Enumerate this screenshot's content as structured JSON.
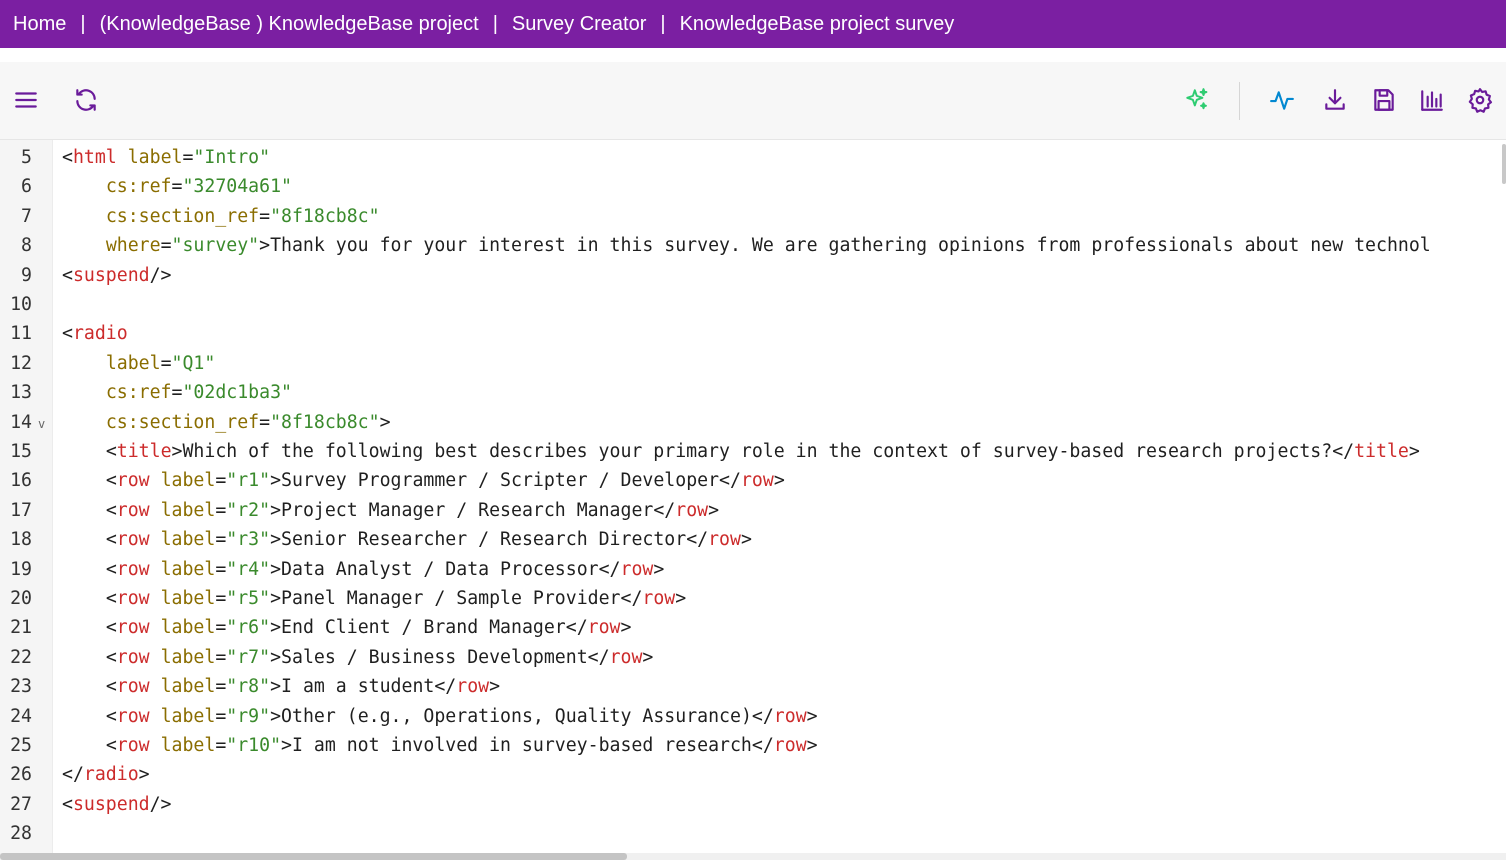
{
  "breadcrumb": {
    "items": [
      "Home",
      "(KnowledgeBase ) KnowledgeBase project",
      "Survey Creator",
      "KnowledgeBase project survey"
    ],
    "separator": "|"
  },
  "toolbar": {
    "left_icons": [
      "menu-icon",
      "refresh-icon"
    ],
    "right_icons": [
      "ai-sparkle-icon",
      "activity-icon",
      "download-icon",
      "save-icon",
      "chart-icon",
      "settings-icon"
    ],
    "colors": {
      "accent": "#7b1fa2",
      "ai": "#2ecc71",
      "icon": "#6a1b9a",
      "activity": "#0288d1"
    }
  },
  "editor": {
    "lines": [
      {
        "n": "5",
        "tokens": [
          [
            "br",
            "<"
          ],
          [
            "tag",
            "html"
          ],
          [
            "txt",
            " "
          ],
          [
            "attr",
            "label"
          ],
          [
            "br",
            "="
          ],
          [
            "val",
            "\"Intro\""
          ]
        ]
      },
      {
        "n": "6",
        "tokens": [
          [
            "txt",
            "    "
          ],
          [
            "attr",
            "cs:ref"
          ],
          [
            "br",
            "="
          ],
          [
            "val",
            "\"32704a61\""
          ]
        ]
      },
      {
        "n": "7",
        "tokens": [
          [
            "txt",
            "    "
          ],
          [
            "attr",
            "cs:section_ref"
          ],
          [
            "br",
            "="
          ],
          [
            "val",
            "\"8f18cb8c\""
          ]
        ]
      },
      {
        "n": "8",
        "tokens": [
          [
            "txt",
            "    "
          ],
          [
            "attr",
            "where"
          ],
          [
            "br",
            "="
          ],
          [
            "val",
            "\"survey\""
          ],
          [
            "br",
            ">"
          ],
          [
            "txt",
            "Thank you for your interest in this survey. We are gathering opinions from professionals about new technol"
          ]
        ]
      },
      {
        "n": "9",
        "tokens": [
          [
            "br",
            "<"
          ],
          [
            "tag",
            "suspend"
          ],
          [
            "br",
            "/>"
          ]
        ]
      },
      {
        "n": "10",
        "tokens": []
      },
      {
        "n": "11",
        "tokens": [
          [
            "br",
            "<"
          ],
          [
            "tag",
            "radio"
          ]
        ]
      },
      {
        "n": "12",
        "tokens": [
          [
            "txt",
            "    "
          ],
          [
            "attr",
            "label"
          ],
          [
            "br",
            "="
          ],
          [
            "val",
            "\"Q1\""
          ]
        ]
      },
      {
        "n": "13",
        "tokens": [
          [
            "txt",
            "    "
          ],
          [
            "attr",
            "cs:ref"
          ],
          [
            "br",
            "="
          ],
          [
            "val",
            "\"02dc1ba3\""
          ]
        ]
      },
      {
        "n": "14",
        "fold": "v",
        "tokens": [
          [
            "txt",
            "    "
          ],
          [
            "attr",
            "cs:section_ref"
          ],
          [
            "br",
            "="
          ],
          [
            "val",
            "\"8f18cb8c\""
          ],
          [
            "br",
            ">"
          ]
        ]
      },
      {
        "n": "15",
        "tokens": [
          [
            "txt",
            "    "
          ],
          [
            "br",
            "<"
          ],
          [
            "tag",
            "title"
          ],
          [
            "br",
            ">"
          ],
          [
            "txt",
            "Which of the following best describes your primary role in the context of survey-based research projects?"
          ],
          [
            "br",
            "</"
          ],
          [
            "tag",
            "title"
          ],
          [
            "br",
            ">"
          ]
        ]
      },
      {
        "n": "16",
        "tokens": [
          [
            "txt",
            "    "
          ],
          [
            "br",
            "<"
          ],
          [
            "tag",
            "row"
          ],
          [
            "txt",
            " "
          ],
          [
            "attr",
            "label"
          ],
          [
            "br",
            "="
          ],
          [
            "val",
            "\"r1\""
          ],
          [
            "br",
            ">"
          ],
          [
            "txt",
            "Survey Programmer / Scripter / Developer"
          ],
          [
            "br",
            "</"
          ],
          [
            "tag",
            "row"
          ],
          [
            "br",
            ">"
          ]
        ]
      },
      {
        "n": "17",
        "tokens": [
          [
            "txt",
            "    "
          ],
          [
            "br",
            "<"
          ],
          [
            "tag",
            "row"
          ],
          [
            "txt",
            " "
          ],
          [
            "attr",
            "label"
          ],
          [
            "br",
            "="
          ],
          [
            "val",
            "\"r2\""
          ],
          [
            "br",
            ">"
          ],
          [
            "txt",
            "Project Manager / Research Manager"
          ],
          [
            "br",
            "</"
          ],
          [
            "tag",
            "row"
          ],
          [
            "br",
            ">"
          ]
        ]
      },
      {
        "n": "18",
        "tokens": [
          [
            "txt",
            "    "
          ],
          [
            "br",
            "<"
          ],
          [
            "tag",
            "row"
          ],
          [
            "txt",
            " "
          ],
          [
            "attr",
            "label"
          ],
          [
            "br",
            "="
          ],
          [
            "val",
            "\"r3\""
          ],
          [
            "br",
            ">"
          ],
          [
            "txt",
            "Senior Researcher / Research Director"
          ],
          [
            "br",
            "</"
          ],
          [
            "tag",
            "row"
          ],
          [
            "br",
            ">"
          ]
        ]
      },
      {
        "n": "19",
        "tokens": [
          [
            "txt",
            "    "
          ],
          [
            "br",
            "<"
          ],
          [
            "tag",
            "row"
          ],
          [
            "txt",
            " "
          ],
          [
            "attr",
            "label"
          ],
          [
            "br",
            "="
          ],
          [
            "val",
            "\"r4\""
          ],
          [
            "br",
            ">"
          ],
          [
            "txt",
            "Data Analyst / Data Processor"
          ],
          [
            "br",
            "</"
          ],
          [
            "tag",
            "row"
          ],
          [
            "br",
            ">"
          ]
        ]
      },
      {
        "n": "20",
        "tokens": [
          [
            "txt",
            "    "
          ],
          [
            "br",
            "<"
          ],
          [
            "tag",
            "row"
          ],
          [
            "txt",
            " "
          ],
          [
            "attr",
            "label"
          ],
          [
            "br",
            "="
          ],
          [
            "val",
            "\"r5\""
          ],
          [
            "br",
            ">"
          ],
          [
            "txt",
            "Panel Manager / Sample Provider"
          ],
          [
            "br",
            "</"
          ],
          [
            "tag",
            "row"
          ],
          [
            "br",
            ">"
          ]
        ]
      },
      {
        "n": "21",
        "tokens": [
          [
            "txt",
            "    "
          ],
          [
            "br",
            "<"
          ],
          [
            "tag",
            "row"
          ],
          [
            "txt",
            " "
          ],
          [
            "attr",
            "label"
          ],
          [
            "br",
            "="
          ],
          [
            "val",
            "\"r6\""
          ],
          [
            "br",
            ">"
          ],
          [
            "txt",
            "End Client / Brand Manager"
          ],
          [
            "br",
            "</"
          ],
          [
            "tag",
            "row"
          ],
          [
            "br",
            ">"
          ]
        ]
      },
      {
        "n": "22",
        "tokens": [
          [
            "txt",
            "    "
          ],
          [
            "br",
            "<"
          ],
          [
            "tag",
            "row"
          ],
          [
            "txt",
            " "
          ],
          [
            "attr",
            "label"
          ],
          [
            "br",
            "="
          ],
          [
            "val",
            "\"r7\""
          ],
          [
            "br",
            ">"
          ],
          [
            "txt",
            "Sales / Business Development"
          ],
          [
            "br",
            "</"
          ],
          [
            "tag",
            "row"
          ],
          [
            "br",
            ">"
          ]
        ]
      },
      {
        "n": "23",
        "tokens": [
          [
            "txt",
            "    "
          ],
          [
            "br",
            "<"
          ],
          [
            "tag",
            "row"
          ],
          [
            "txt",
            " "
          ],
          [
            "attr",
            "label"
          ],
          [
            "br",
            "="
          ],
          [
            "val",
            "\"r8\""
          ],
          [
            "br",
            ">"
          ],
          [
            "txt",
            "I am a student"
          ],
          [
            "br",
            "</"
          ],
          [
            "tag",
            "row"
          ],
          [
            "br",
            ">"
          ]
        ]
      },
      {
        "n": "24",
        "tokens": [
          [
            "txt",
            "    "
          ],
          [
            "br",
            "<"
          ],
          [
            "tag",
            "row"
          ],
          [
            "txt",
            " "
          ],
          [
            "attr",
            "label"
          ],
          [
            "br",
            "="
          ],
          [
            "val",
            "\"r9\""
          ],
          [
            "br",
            ">"
          ],
          [
            "txt",
            "Other (e.g., Operations, Quality Assurance)"
          ],
          [
            "br",
            "</"
          ],
          [
            "tag",
            "row"
          ],
          [
            "br",
            ">"
          ]
        ]
      },
      {
        "n": "25",
        "tokens": [
          [
            "txt",
            "    "
          ],
          [
            "br",
            "<"
          ],
          [
            "tag",
            "row"
          ],
          [
            "txt",
            " "
          ],
          [
            "attr",
            "label"
          ],
          [
            "br",
            "="
          ],
          [
            "val",
            "\"r10\""
          ],
          [
            "br",
            ">"
          ],
          [
            "txt",
            "I am not involved in survey-based research"
          ],
          [
            "br",
            "</"
          ],
          [
            "tag",
            "row"
          ],
          [
            "br",
            ">"
          ]
        ]
      },
      {
        "n": "26",
        "tokens": [
          [
            "br",
            "</"
          ],
          [
            "tag",
            "radio"
          ],
          [
            "br",
            ">"
          ]
        ]
      },
      {
        "n": "27",
        "tokens": [
          [
            "br",
            "<"
          ],
          [
            "tag",
            "suspend"
          ],
          [
            "br",
            "/>"
          ]
        ]
      },
      {
        "n": "28",
        "tokens": []
      }
    ]
  }
}
